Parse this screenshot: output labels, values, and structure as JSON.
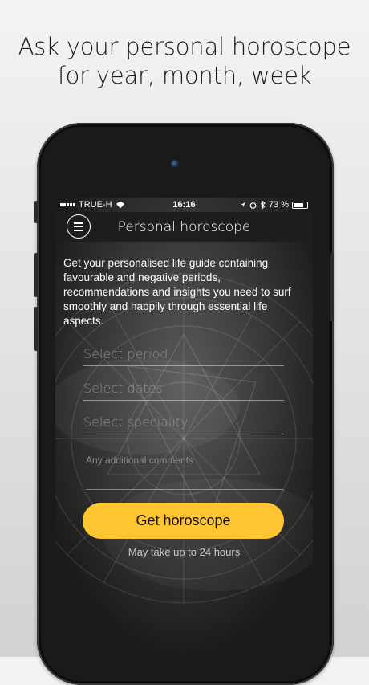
{
  "headline": {
    "line1": "Ask your personal horoscope",
    "line2": "for year, month, week"
  },
  "status_bar": {
    "carrier": "TRUE-H",
    "time": "16:16",
    "battery": "73 %",
    "battery_level": 0.73,
    "icons": [
      "signal-dots-icon",
      "wifi-icon",
      "location-icon",
      "alarm-icon",
      "bluetooth-icon",
      "battery-icon"
    ]
  },
  "nav": {
    "title": "Personal horoscope",
    "menu_icon": "hamburger-menu-icon"
  },
  "intro_text": "Get your personalised life guide containing favourable and negative periods, recommendations and insights you need to surf smoothly and happily through essential life aspects.",
  "form": {
    "period_placeholder": "Select period",
    "dates_placeholder": "Select dates",
    "speciality_placeholder": "Select speciality",
    "comments_placeholder": "Any additional comments"
  },
  "cta_label": "Get horoscope",
  "note": "May take up to 24 hours",
  "colors": {
    "accent": "#fcc531",
    "screen_bg": "#202020",
    "page_bg": "#e6e6e6"
  }
}
